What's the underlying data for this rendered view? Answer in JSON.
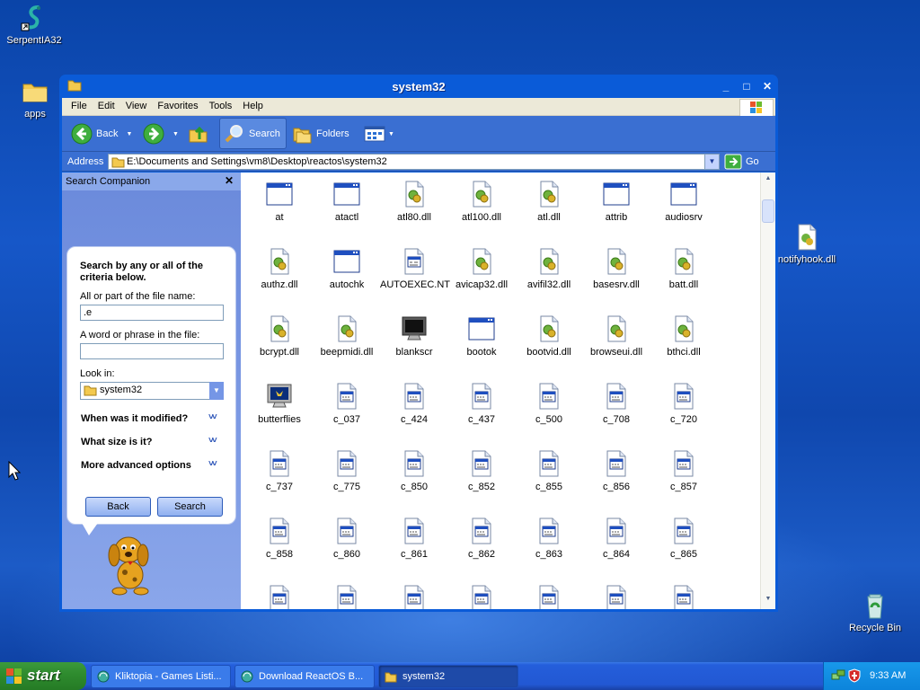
{
  "desktop": {
    "icons": [
      {
        "label": "SerpentIA32",
        "icon": "serpent-icon"
      },
      {
        "label": "apps",
        "icon": "folder-icon"
      },
      {
        "label": "notifyhook.dll",
        "icon": "dll-icon"
      },
      {
        "label": "Recycle Bin",
        "icon": "recycle-bin-icon"
      }
    ]
  },
  "window": {
    "title": "system32",
    "menu": [
      "File",
      "Edit",
      "View",
      "Favorites",
      "Tools",
      "Help"
    ],
    "toolbar": {
      "back": "Back",
      "search": "Search",
      "folders": "Folders"
    },
    "address": {
      "label": "Address",
      "value": "E:\\Documents and Settings\\vm8\\Desktop\\reactos\\system32",
      "go": "Go"
    },
    "search_pane": {
      "header": "Search Companion",
      "heading": "Search by any or all of the criteria below.",
      "filename_label": "All or part of the file name:",
      "filename_value": ".e",
      "phrase_label": "A word or phrase in the file:",
      "phrase_value": "",
      "lookin_label": "Look in:",
      "lookin_value": "system32",
      "sections": [
        "When was it modified?",
        "What size is it?",
        "More advanced options"
      ],
      "back_button": "Back",
      "search_button": "Search"
    },
    "files": [
      {
        "name": "at",
        "type": "app"
      },
      {
        "name": "atactl",
        "type": "app"
      },
      {
        "name": "atl80.dll",
        "type": "dll"
      },
      {
        "name": "atl100.dll",
        "type": "dll"
      },
      {
        "name": "atl.dll",
        "type": "dll"
      },
      {
        "name": "attrib",
        "type": "app"
      },
      {
        "name": "audiosrv",
        "type": "app"
      },
      {
        "name": "authz.dll",
        "type": "dll"
      },
      {
        "name": "autochk",
        "type": "app"
      },
      {
        "name": "AUTOEXEC.NT",
        "type": "sys"
      },
      {
        "name": "avicap32.dll",
        "type": "dll"
      },
      {
        "name": "avifil32.dll",
        "type": "dll"
      },
      {
        "name": "basesrv.dll",
        "type": "dll"
      },
      {
        "name": "batt.dll",
        "type": "dll"
      },
      {
        "name": "bcrypt.dll",
        "type": "dll"
      },
      {
        "name": "beepmidi.dll",
        "type": "dll"
      },
      {
        "name": "blankscr",
        "type": "monitor"
      },
      {
        "name": "bootok",
        "type": "app"
      },
      {
        "name": "bootvid.dll",
        "type": "dll"
      },
      {
        "name": "browseui.dll",
        "type": "dll"
      },
      {
        "name": "bthci.dll",
        "type": "dll"
      },
      {
        "name": "butterflies",
        "type": "screensaver"
      },
      {
        "name": "c_037",
        "type": "nls"
      },
      {
        "name": "c_424",
        "type": "nls"
      },
      {
        "name": "c_437",
        "type": "nls"
      },
      {
        "name": "c_500",
        "type": "nls"
      },
      {
        "name": "c_708",
        "type": "nls"
      },
      {
        "name": "c_720",
        "type": "nls"
      },
      {
        "name": "c_737",
        "type": "nls"
      },
      {
        "name": "c_775",
        "type": "nls"
      },
      {
        "name": "c_850",
        "type": "nls"
      },
      {
        "name": "c_852",
        "type": "nls"
      },
      {
        "name": "c_855",
        "type": "nls"
      },
      {
        "name": "c_856",
        "type": "nls"
      },
      {
        "name": "c_857",
        "type": "nls"
      },
      {
        "name": "c_858",
        "type": "nls"
      },
      {
        "name": "c_860",
        "type": "nls"
      },
      {
        "name": "c_861",
        "type": "nls"
      },
      {
        "name": "c_862",
        "type": "nls"
      },
      {
        "name": "c_863",
        "type": "nls"
      },
      {
        "name": "c_864",
        "type": "nls"
      },
      {
        "name": "c_865",
        "type": "nls"
      },
      {
        "name": "",
        "type": "nls"
      },
      {
        "name": "",
        "type": "nls"
      },
      {
        "name": "",
        "type": "nls"
      },
      {
        "name": "",
        "type": "nls"
      },
      {
        "name": "",
        "type": "nls"
      },
      {
        "name": "",
        "type": "nls"
      },
      {
        "name": "",
        "type": "nls"
      }
    ]
  },
  "taskbar": {
    "start": "start",
    "items": [
      {
        "label": "Kliktopia - Games Listi...",
        "active": false
      },
      {
        "label": "Download ReactOS B...",
        "active": false
      },
      {
        "label": "system32",
        "active": true
      }
    ],
    "clock": "9:33 AM"
  },
  "colors": {
    "titlebar": "#0a5bd8",
    "toolbar": "#3a6fd2",
    "taskbar": "#245edb",
    "start": "#2f8c2f",
    "tray": "#0c84db"
  }
}
